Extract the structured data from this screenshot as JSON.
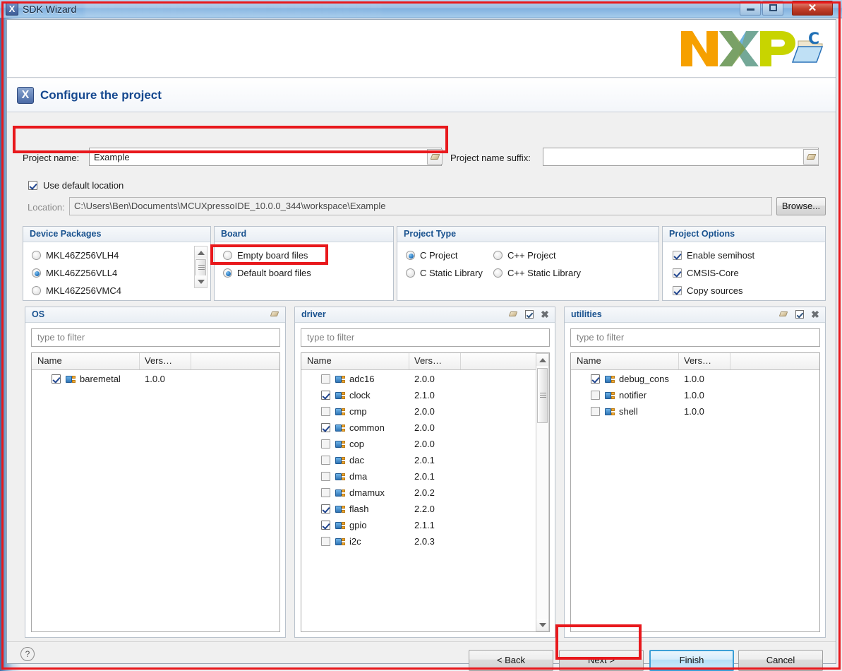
{
  "window": {
    "title": "SDK Wizard",
    "icon": "x-logo-icon",
    "controls": {
      "minimize": "–",
      "maximize": "□",
      "close": "✕"
    }
  },
  "banner": {
    "logo": "NXP",
    "product_icon": "c-project-folder-icon"
  },
  "header": {
    "title": "Configure the project",
    "icon": "x-logo-icon"
  },
  "project": {
    "name_label": "Project name:",
    "name_value": "Example",
    "suffix_label": "Project name suffix:",
    "suffix_value": "",
    "use_default_location_label": "Use default location",
    "use_default_location_checked": true,
    "location_label": "Location:",
    "location_value": "C:\\Users\\Ben\\Documents\\MCUXpressoIDE_10.0.0_344\\workspace\\Example",
    "browse_label": "Browse..."
  },
  "device_packages": {
    "title": "Device Packages",
    "options": [
      {
        "label": "MKL46Z256VLH4",
        "selected": false
      },
      {
        "label": "MKL46Z256VLL4",
        "selected": true
      },
      {
        "label": "MKL46Z256VMC4",
        "selected": false
      }
    ]
  },
  "board": {
    "title": "Board",
    "options": [
      {
        "label": "Empty board files",
        "selected": false
      },
      {
        "label": "Default board files",
        "selected": true
      }
    ]
  },
  "project_type": {
    "title": "Project Type",
    "options": [
      {
        "label": "C Project",
        "selected": true
      },
      {
        "label": "C++ Project",
        "selected": false
      },
      {
        "label": "C Static Library",
        "selected": false
      },
      {
        "label": "C++ Static Library",
        "selected": false
      }
    ]
  },
  "project_options": {
    "title": "Project Options",
    "options": [
      {
        "label": "Enable semihost",
        "checked": true
      },
      {
        "label": "CMSIS-Core",
        "checked": true
      },
      {
        "label": "Copy sources",
        "checked": true
      }
    ]
  },
  "os_panel": {
    "title": "OS",
    "filter_placeholder": "type to filter",
    "columns": [
      "Name",
      "Vers…"
    ],
    "rows": [
      {
        "name": "baremetal",
        "version": "1.0.0",
        "checked": true
      }
    ]
  },
  "driver_panel": {
    "title": "driver",
    "filter_placeholder": "type to filter",
    "columns": [
      "Name",
      "Vers…"
    ],
    "rows": [
      {
        "name": "adc16",
        "version": "2.0.0",
        "checked": false
      },
      {
        "name": "clock",
        "version": "2.1.0",
        "checked": true
      },
      {
        "name": "cmp",
        "version": "2.0.0",
        "checked": false
      },
      {
        "name": "common",
        "version": "2.0.0",
        "checked": true
      },
      {
        "name": "cop",
        "version": "2.0.0",
        "checked": false
      },
      {
        "name": "dac",
        "version": "2.0.1",
        "checked": false
      },
      {
        "name": "dma",
        "version": "2.0.1",
        "checked": false
      },
      {
        "name": "dmamux",
        "version": "2.0.2",
        "checked": false
      },
      {
        "name": "flash",
        "version": "2.2.0",
        "checked": true
      },
      {
        "name": "gpio",
        "version": "2.1.1",
        "checked": true
      },
      {
        "name": "i2c",
        "version": "2.0.3",
        "checked": false
      }
    ]
  },
  "utilities_panel": {
    "title": "utilities",
    "filter_placeholder": "type to filter",
    "columns": [
      "Name",
      "Vers…"
    ],
    "rows": [
      {
        "name": "debug_cons",
        "version": "1.0.0",
        "checked": true
      },
      {
        "name": "notifier",
        "version": "1.0.0",
        "checked": false
      },
      {
        "name": "shell",
        "version": "1.0.0",
        "checked": false
      }
    ]
  },
  "buttons": {
    "back": "< Back",
    "next": "Next >",
    "finish": "Finish",
    "cancel": "Cancel",
    "help": "?"
  },
  "colors": {
    "annotation": "#e8181c",
    "heading": "#15488f",
    "default_button": "#3c9fd6"
  }
}
